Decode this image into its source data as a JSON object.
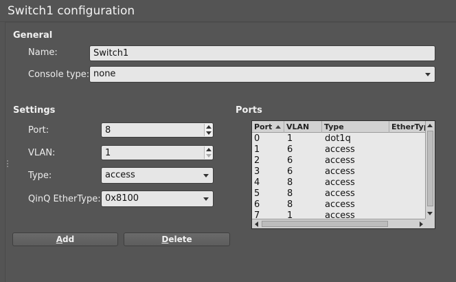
{
  "window": {
    "title": "Switch1 configuration"
  },
  "general": {
    "section_title": "General",
    "name_label": "Name:",
    "name_value": "Switch1",
    "console_label": "Console type:",
    "console_value": "none"
  },
  "settings": {
    "section_title": "Settings",
    "port_label": "Port:",
    "port_value": "8",
    "vlan_label": "VLAN:",
    "vlan_value": "1",
    "type_label": "Type:",
    "type_value": "access",
    "qinq_label": "QinQ EtherType:",
    "qinq_value": "0x8100"
  },
  "ports": {
    "section_title": "Ports",
    "columns": [
      "Port",
      "VLAN",
      "Type",
      "EtherTyp"
    ],
    "rows": [
      [
        "0",
        "1",
        "dot1q",
        ""
      ],
      [
        "1",
        "6",
        "access",
        ""
      ],
      [
        "2",
        "6",
        "access",
        ""
      ],
      [
        "3",
        "6",
        "access",
        ""
      ],
      [
        "4",
        "8",
        "access",
        ""
      ],
      [
        "5",
        "8",
        "access",
        ""
      ],
      [
        "6",
        "8",
        "access",
        ""
      ],
      [
        "7",
        "1",
        "access",
        ""
      ]
    ]
  },
  "buttons": {
    "add_first": "A",
    "add_rest": "dd",
    "delete_first": "D",
    "delete_rest": "elete"
  }
}
